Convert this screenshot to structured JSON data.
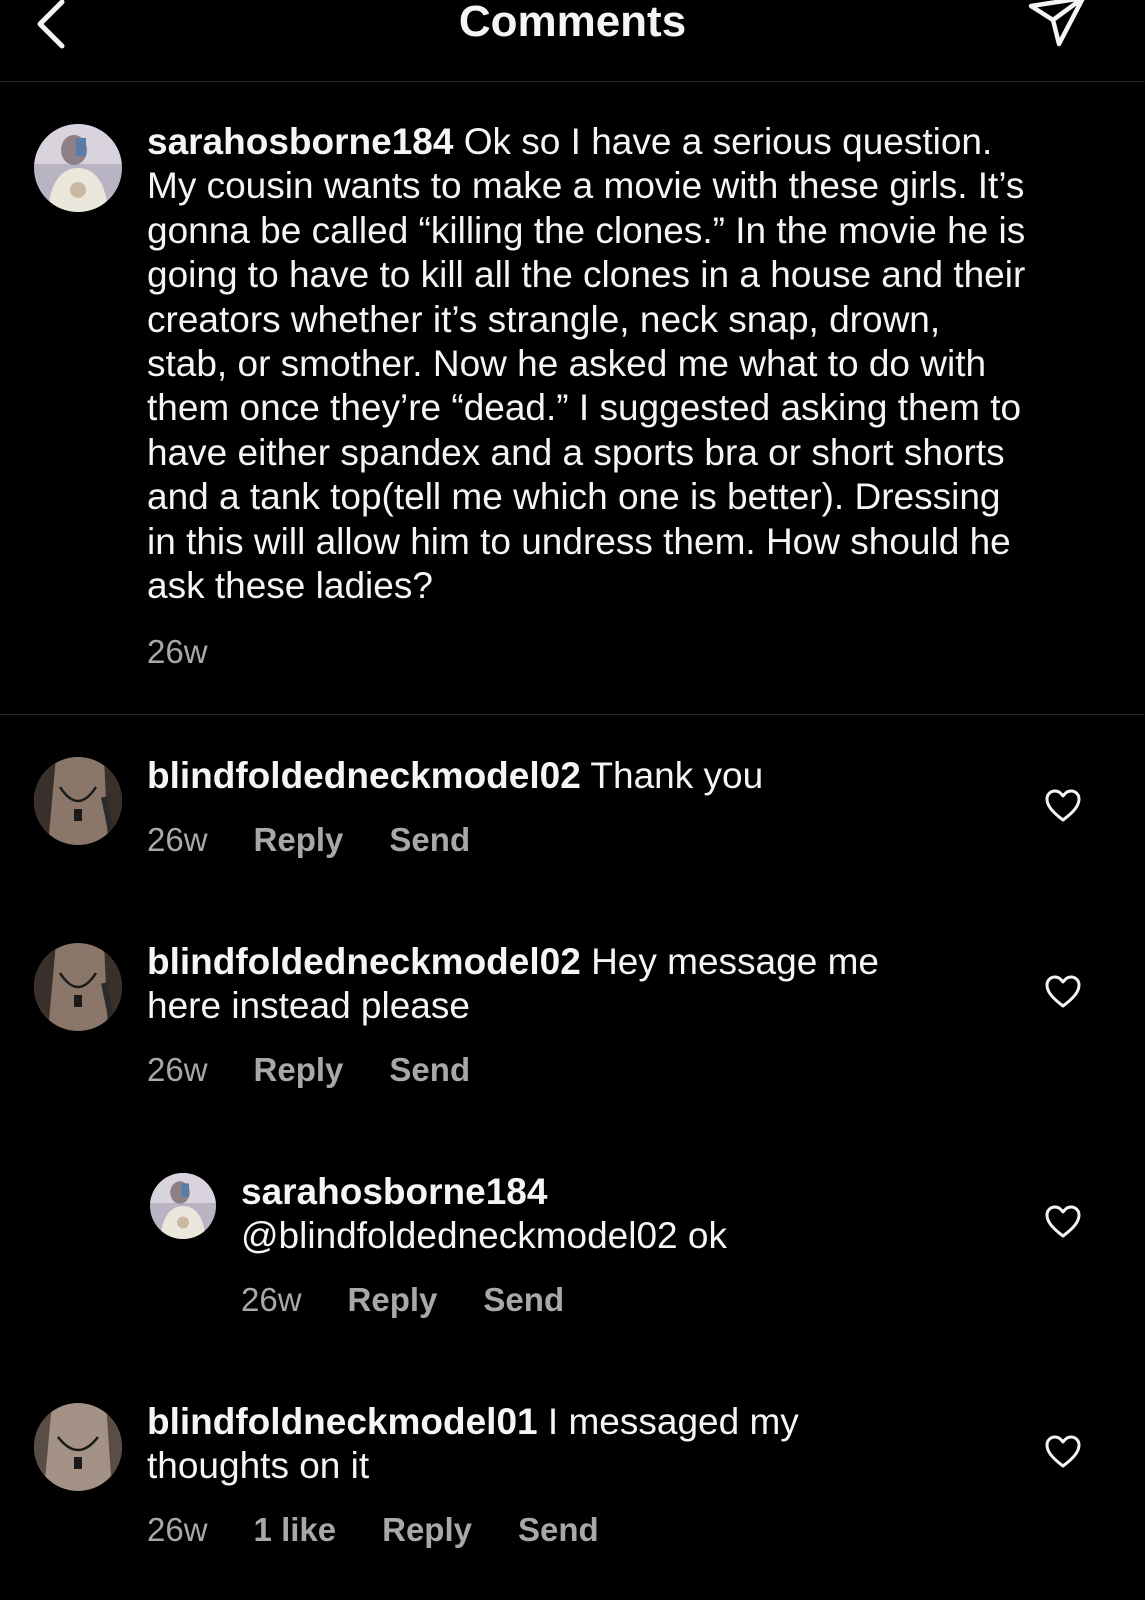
{
  "header": {
    "title": "Comments",
    "back_icon": "chevron-left-icon",
    "share_icon": "paper-plane-icon"
  },
  "caption": {
    "username": "sarahosborne184",
    "text": "Ok so I have a serious question.\nMy cousin wants to make a movie with these girls. It’s\ngonna be called “killing the clones.” In the movie he is\ngoing to have to kill all the clones in a house and their\ncreators whether it’s strangle, neck snap, drown,\nstab, or smother. Now he asked me what to do with\nthem once they’re “dead.” I suggested asking them to\nhave either spandex and a sports bra or short shorts\nand a tank top(tell me which one is better). Dressing\nin this will allow him to undress them. How should he\nask these ladies?",
    "time": "26w"
  },
  "comments": [
    {
      "username": "blindfoldedneckmodel02",
      "text": " Thank you",
      "time": "26w",
      "reply_label": "Reply",
      "send_label": "Send"
    },
    {
      "username": "blindfoldedneckmodel02",
      "text": " Hey message me\nhere instead please",
      "time": "26w",
      "reply_label": "Reply",
      "send_label": "Send"
    },
    {
      "username": "sarahosborne184",
      "text": "\n@blindfoldedneckmodel02 ok",
      "time": "26w",
      "reply_label": "Reply",
      "send_label": "Send"
    },
    {
      "username": "blindfoldneckmodel01",
      "text": " I messaged my\nthoughts on it",
      "time": "26w",
      "likes": "1 like",
      "reply_label": "Reply",
      "send_label": "Send"
    }
  ],
  "colors": {
    "background": "#000000",
    "text": "#f5f5f5",
    "secondary_text": "#a8a8a8",
    "divider": "#262626"
  }
}
